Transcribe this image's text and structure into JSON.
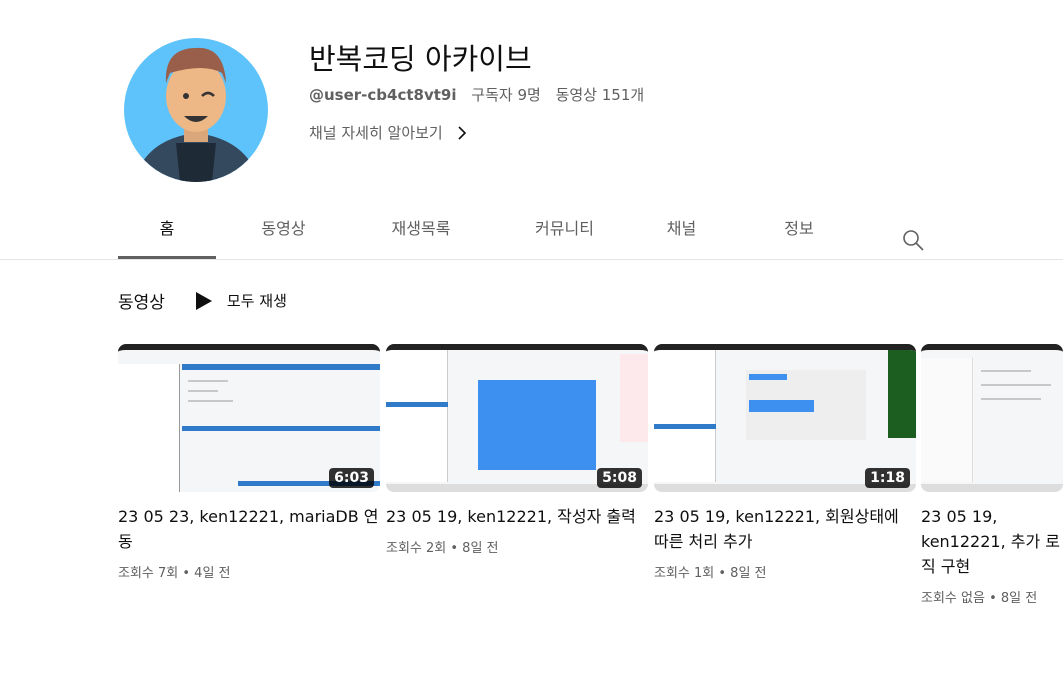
{
  "channel": {
    "name": "반복코딩 아카이브",
    "handle": "@user-cb4ct8vt9i",
    "subscribers": "구독자 9명",
    "video_count": "동영상 151개",
    "more_link": "채널 자세히 알아보기"
  },
  "tabs": [
    {
      "label": "홈",
      "active": true
    },
    {
      "label": "동영상"
    },
    {
      "label": "재생목록"
    },
    {
      "label": "커뮤니티"
    },
    {
      "label": "채널"
    },
    {
      "label": "정보"
    }
  ],
  "section": {
    "title": "동영상",
    "play_all": "모두 재생"
  },
  "videos": [
    {
      "title": "23 05 23, ken12221, mariaDB 연동",
      "duration": "6:03",
      "meta": "조회수 7회 • 4일 전"
    },
    {
      "title": "23 05 19, ken12221, 작성자 출력",
      "duration": "5:08",
      "meta": "조회수 2회 • 8일 전"
    },
    {
      "title": "23 05 19, ken12221, 회원상태에 따른 처리 추가",
      "duration": "1:18",
      "meta": "조회수 1회 • 8일 전"
    },
    {
      "title": "23 05 19, ken12221, 추가 로직 구현",
      "duration": "",
      "meta": "조회수 없음 • 8일 전"
    }
  ]
}
